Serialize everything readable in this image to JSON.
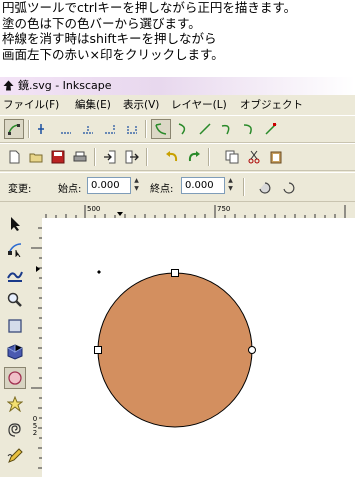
{
  "caption": {
    "lines": [
      "円弧ツールでctrlキーを押しながら正円を描きます。",
      "塗の色は下の色バーから選びます。",
      "枠線を消す時はshiftキーを押しながら",
      "画面左下の赤い×印をクリックします。"
    ]
  },
  "window": {
    "title": "鏡.svg - Inkscape"
  },
  "menu": {
    "items": [
      "ファイル(F)",
      "編集(E)",
      "表示(V)",
      "レイヤー(L)",
      "オブジェクト"
    ]
  },
  "controls": {
    "change_label": "変更:",
    "start_label": "始点:",
    "start_value": "0.000",
    "end_label": "終点:",
    "end_value": "0.000"
  },
  "ruler": {
    "h_ticks": [
      "500",
      "750"
    ],
    "v_ticks": [
      "0",
      "5",
      "2"
    ]
  },
  "canvas": {
    "circle_fill": "#d38f5f",
    "circle_stroke": "#000000"
  },
  "colors": {
    "titlebar_start": "#f3e3f6",
    "chrome": "#ece9d8",
    "active_tool": "#d8d4c2"
  }
}
